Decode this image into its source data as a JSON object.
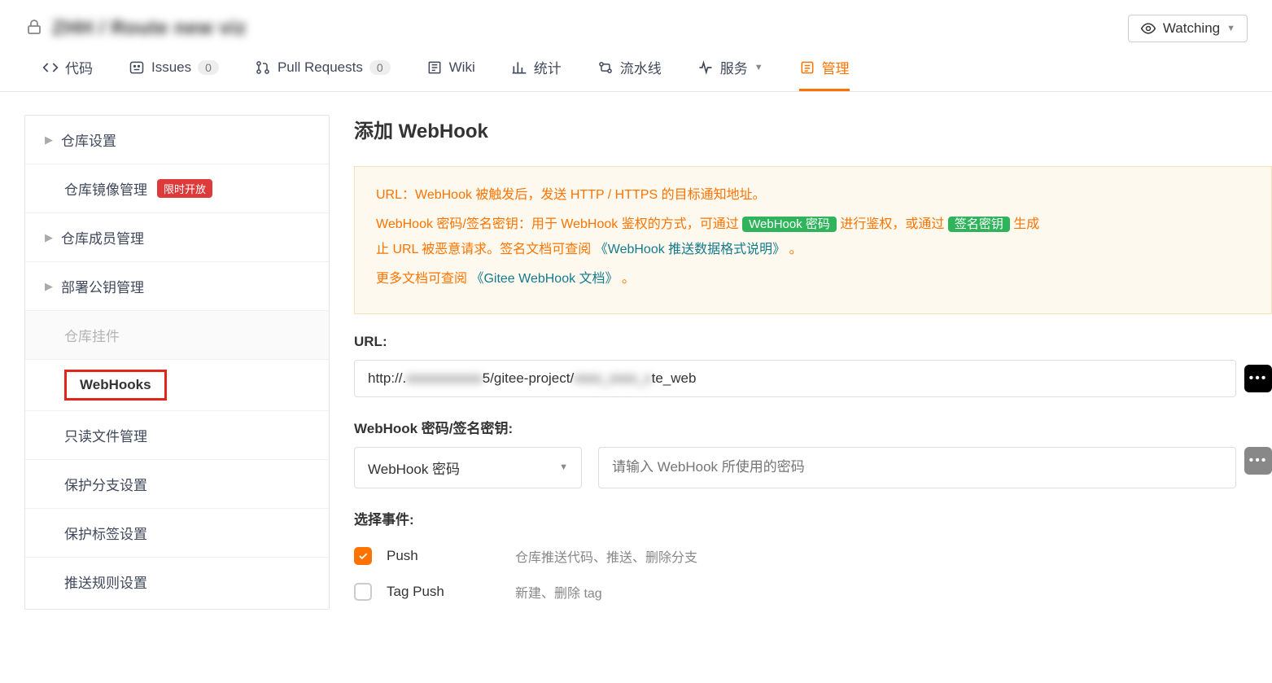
{
  "header": {
    "repo_title_blurred": "ZHH / Route new viz",
    "watch_label": "Watching"
  },
  "tabs": {
    "code": "代码",
    "issues": "Issues",
    "issues_count": "0",
    "pull_requests": "Pull Requests",
    "pr_count": "0",
    "wiki": "Wiki",
    "stats": "统计",
    "pipeline": "流水线",
    "service": "服务",
    "manage": "管理"
  },
  "sidebar": {
    "repo_settings": "仓库设置",
    "mirror_mgmt": "仓库镜像管理",
    "mirror_badge": "限时开放",
    "member_mgmt": "仓库成员管理",
    "deploy_key": "部署公钥管理",
    "repo_plugin": "仓库挂件",
    "webhooks": "WebHooks",
    "readonly_file": "只读文件管理",
    "protected_branch": "保护分支设置",
    "protected_tag": "保护标签设置",
    "push_rule": "推送规则设置"
  },
  "main": {
    "title": "添加 WebHook",
    "notice": {
      "line1_a": "URL：WebHook 被触发后，发送 HTTP / HTTPS 的目标通知地址。",
      "line2_a": "WebHook 密码/签名密钥：用于 WebHook 鉴权的方式，可通过 ",
      "tag_pwd": "WebHook 密码",
      "line2_b": " 进行鉴权，或通过 ",
      "tag_key": "签名密钥",
      "line2_c": " 生成",
      "line2_d": "止 URL 被恶意请求。签名文档可查阅 ",
      "link1": "《WebHook 推送数据格式说明》",
      "line2_e": " 。",
      "line3_a": "更多文档可查阅 ",
      "link2": "《Gitee WebHook 文档》",
      "line3_b": " 。"
    },
    "url_label": "URL:",
    "url_prefix": "http://.",
    "url_mid": "5/gitee-project/",
    "url_suffix": "te_web",
    "pwd_label": "WebHook 密码/签名密钥:",
    "pwd_select": "WebHook 密码",
    "pwd_placeholder": "请输入 WebHook 所使用的密码",
    "events_label": "选择事件:",
    "events": [
      {
        "label": "Push",
        "desc": "仓库推送代码、推送、删除分支",
        "checked": true
      },
      {
        "label": "Tag Push",
        "desc": "新建、删除 tag",
        "checked": false
      }
    ]
  }
}
